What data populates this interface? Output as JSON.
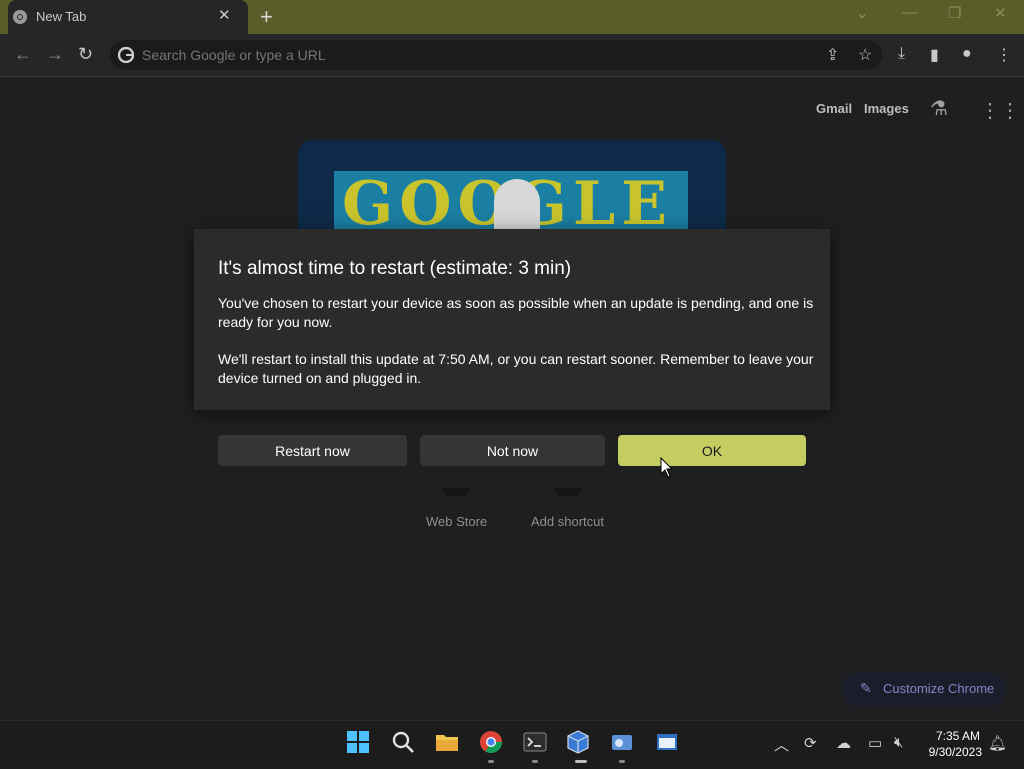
{
  "browser": {
    "tab_title": "New Tab",
    "omnibox_placeholder": "Search Google or type a URL"
  },
  "ntp": {
    "gmail": "Gmail",
    "images": "Images",
    "doodle_text": "GOOGLE",
    "shortcuts": [
      "Web Store",
      "Add shortcut"
    ],
    "customize": "Customize Chrome"
  },
  "dialog": {
    "title": "It's almost time to restart (estimate: 3 min)",
    "p1": "You've chosen to restart your device as soon as possible when an update is pending, and one is ready for you now.",
    "p2": "We'll restart to install this update at 7:50 AM, or you can restart sooner. Remember to leave your device turned on and plugged in.",
    "restart_label": "Restart now",
    "notnow_label": "Not now",
    "ok_label": "OK"
  },
  "taskbar": {
    "time": "7:35 AM",
    "date": "9/30/2023",
    "apps": [
      "windows-start-icon",
      "search-icon",
      "file-explorer-icon",
      "chrome-icon",
      "terminal-icon",
      "virtualbox-icon",
      "settings-app-icon",
      "notepad-app-icon"
    ]
  },
  "colors": {
    "titlebar": "#5a5d2a",
    "accent_button": "#c5cd62",
    "dialog_bg": "#2b2b2b"
  }
}
